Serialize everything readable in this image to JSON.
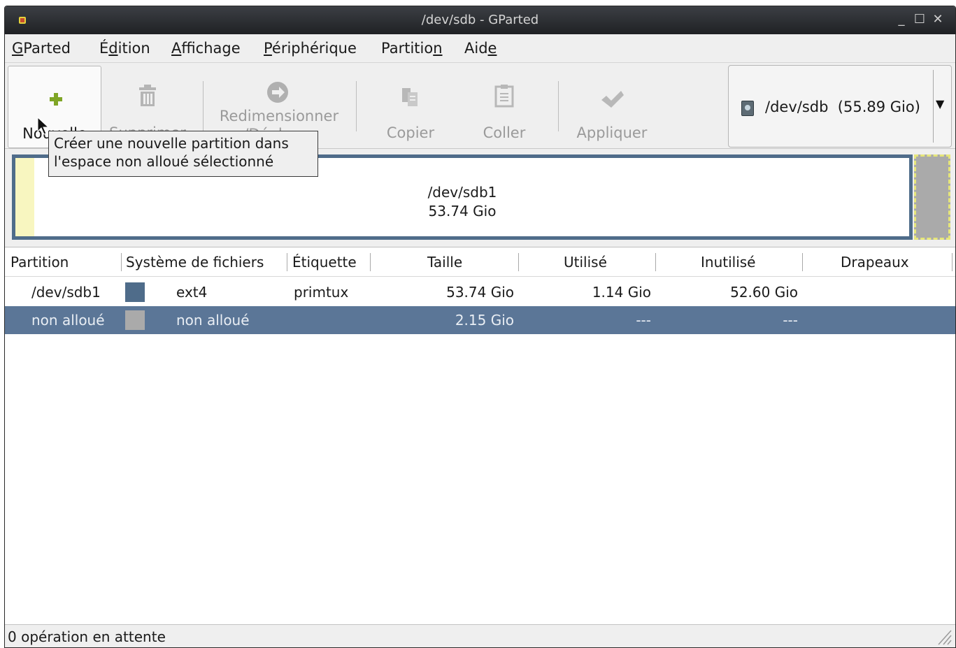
{
  "window": {
    "title": "/dev/sdb - GParted",
    "min_glyph": "_",
    "max_glyph": "☐",
    "close_glyph": "✕"
  },
  "menubar": [
    {
      "pre": "",
      "u": "G",
      "post": "Parted"
    },
    {
      "pre": "É",
      "u": "d",
      "post": "ition"
    },
    {
      "pre": "",
      "u": "A",
      "post": "ffichage"
    },
    {
      "pre": "",
      "u": "P",
      "post": "ériphérique"
    },
    {
      "pre": "Partitio",
      "u": "n",
      "post": ""
    },
    {
      "pre": "Aid",
      "u": "e",
      "post": ""
    }
  ],
  "toolbar": {
    "new_label": "Nouvelle",
    "delete_label": "Supprimer",
    "resize_label_1": "Redimensionner",
    "resize_label_2": "/Déplacer",
    "copy_label": "Copier",
    "paste_label": "Coller",
    "apply_label": "Appliquer"
  },
  "device": {
    "label": "/dev/sdb  (55.89 Gio)",
    "arrow": "▼"
  },
  "tooltip": {
    "line1": "Créer une nouvelle partition dans",
    "line2": "l'espace non alloué sélectionné"
  },
  "diskmap": {
    "name": "/dev/sdb1",
    "size": "53.74 Gio",
    "used_fraction": 0.021
  },
  "table": {
    "headers": [
      "Partition",
      "Système de fichiers",
      "Étiquette",
      "Taille",
      "Utilisé",
      "Inutilisé",
      "Drapeaux"
    ],
    "rows": [
      {
        "partition": "/dev/sdb1",
        "fs": "ext4",
        "label": "primtux",
        "size": "53.74 Gio",
        "used": "1.14 Gio",
        "unused": "52.60 Gio",
        "flags": "",
        "color": "#4f6c8a"
      },
      {
        "partition": "non alloué",
        "fs": "non alloué",
        "label": "",
        "size": "2.15 Gio",
        "used": "---",
        "unused": "---",
        "flags": "",
        "color": "#aaaaaa"
      }
    ]
  },
  "status": {
    "text": "0 opération en attente"
  },
  "colors": {
    "ext4": "#4f6c8a",
    "unallocated": "#aaaaaa",
    "selection": "#5b7697",
    "new_icon": "#7fa526"
  }
}
